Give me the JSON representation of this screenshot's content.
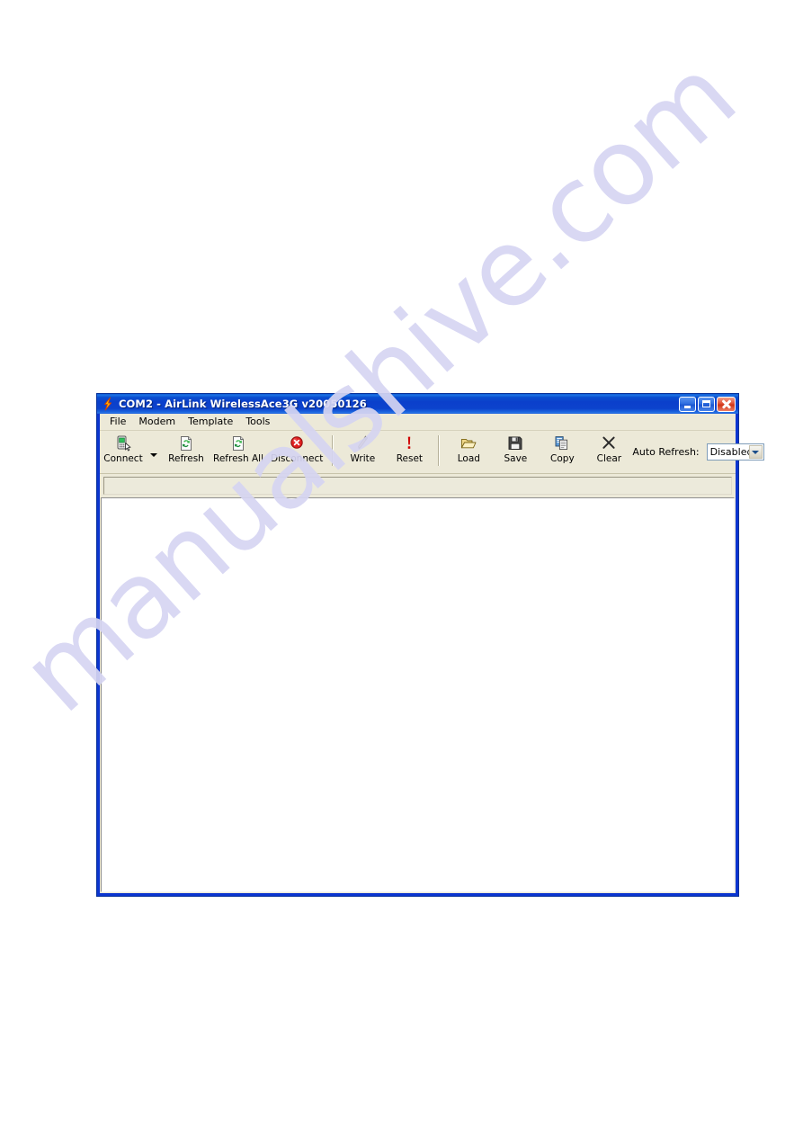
{
  "page": {
    "watermark": "manualshive.com"
  },
  "window": {
    "title": "COM2 - AirLink WirelessAce3G v20050126",
    "title_icon": "lightning-bolt-icon",
    "controls": {
      "minimize": "Minimize",
      "maximize": "Maximize",
      "close": "Close"
    },
    "accent_title_color": "#0b3fcb",
    "face_color": "#ece9d8",
    "frame_color": "#0b35d0"
  },
  "menu": {
    "items": [
      {
        "label": "File"
      },
      {
        "label": "Modem"
      },
      {
        "label": "Template"
      },
      {
        "label": "Tools"
      }
    ]
  },
  "toolbar": {
    "groups": [
      {
        "buttons": [
          {
            "label": "Connect",
            "icon": "modem-connect-icon",
            "has_dropdown": true
          },
          {
            "label": "Refresh",
            "icon": "refresh-document-icon",
            "has_dropdown": false
          },
          {
            "label": "Refresh All",
            "icon": "refresh-all-document-icon",
            "has_dropdown": false
          },
          {
            "label": "Disconnect",
            "icon": "disconnect-red-x-icon",
            "has_dropdown": false
          }
        ]
      },
      {
        "buttons": [
          {
            "label": "Write",
            "icon": "pencil-write-icon",
            "has_dropdown": false
          },
          {
            "label": "Reset",
            "icon": "red-exclamation-reset-icon",
            "has_dropdown": false
          }
        ]
      },
      {
        "buttons": [
          {
            "label": "Load",
            "icon": "open-folder-icon",
            "has_dropdown": false
          },
          {
            "label": "Save",
            "icon": "floppy-disk-icon",
            "has_dropdown": false
          },
          {
            "label": "Copy",
            "icon": "copy-documents-icon",
            "has_dropdown": false
          },
          {
            "label": "Clear",
            "icon": "x-clear-icon",
            "has_dropdown": false
          }
        ]
      }
    ],
    "auto_refresh": {
      "label": "Auto Refresh:",
      "value": "Disabled",
      "options": [
        "Disabled"
      ],
      "dropdown_icon": "chevron-down-icon"
    }
  },
  "status_strip": {
    "text": ""
  },
  "content": {
    "text": ""
  }
}
